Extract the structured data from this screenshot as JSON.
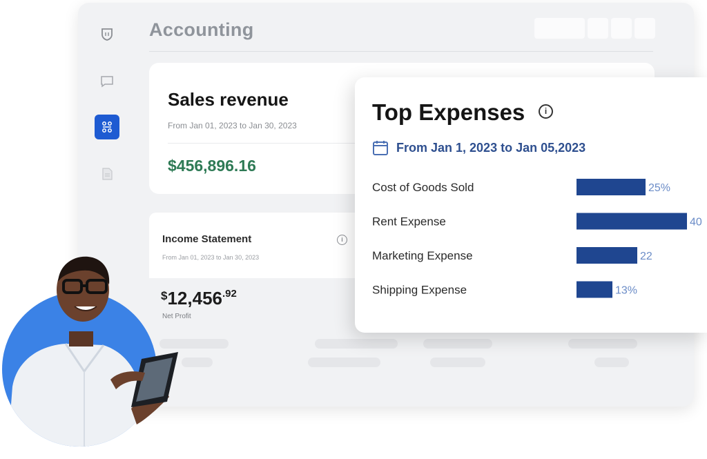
{
  "app": {
    "title": "Accounting"
  },
  "sidebar": {
    "items": [
      {
        "icon": "shield-icon",
        "active": false
      },
      {
        "icon": "chat-icon",
        "active": false
      },
      {
        "icon": "apps-icon",
        "active": true
      },
      {
        "icon": "document-icon",
        "active": false
      }
    ]
  },
  "sales_card": {
    "title": "Sales revenue",
    "date_range": "From Jan 01, 2023 to Jan 30, 2023",
    "amount": "$456,896.16"
  },
  "income_card": {
    "title": "Income Statement",
    "date_range": "From Jan 01, 2023 to Jan 30, 2023",
    "net_amount_currency": "$",
    "net_amount_whole": "12,456",
    "net_amount_cents": ".92",
    "net_label": "Net Profit"
  },
  "expenses_card": {
    "title": "Top Expenses",
    "date_range": "From Jan 1, 2023 to Jan 05,2023"
  },
  "chart_data": {
    "type": "bar",
    "orientation": "horizontal",
    "title": "Top Expenses",
    "categories": [
      "Cost of Goods Sold",
      "Rent Expense",
      "Marketing Expense",
      "Shipping Expense"
    ],
    "values": [
      25,
      40,
      22,
      13
    ],
    "value_labels": [
      "25%",
      "40",
      "22",
      "13%"
    ],
    "xlim": [
      0,
      40
    ],
    "grid": false,
    "legend": "none",
    "bar_color": "#1f4690",
    "label_color": "#6b8cc7"
  },
  "colors": {
    "accent": "#1e5bd2",
    "sales_amount": "#2e7a55",
    "date_link": "#2e4f8f",
    "avatar_circle": "#3b82e6"
  }
}
